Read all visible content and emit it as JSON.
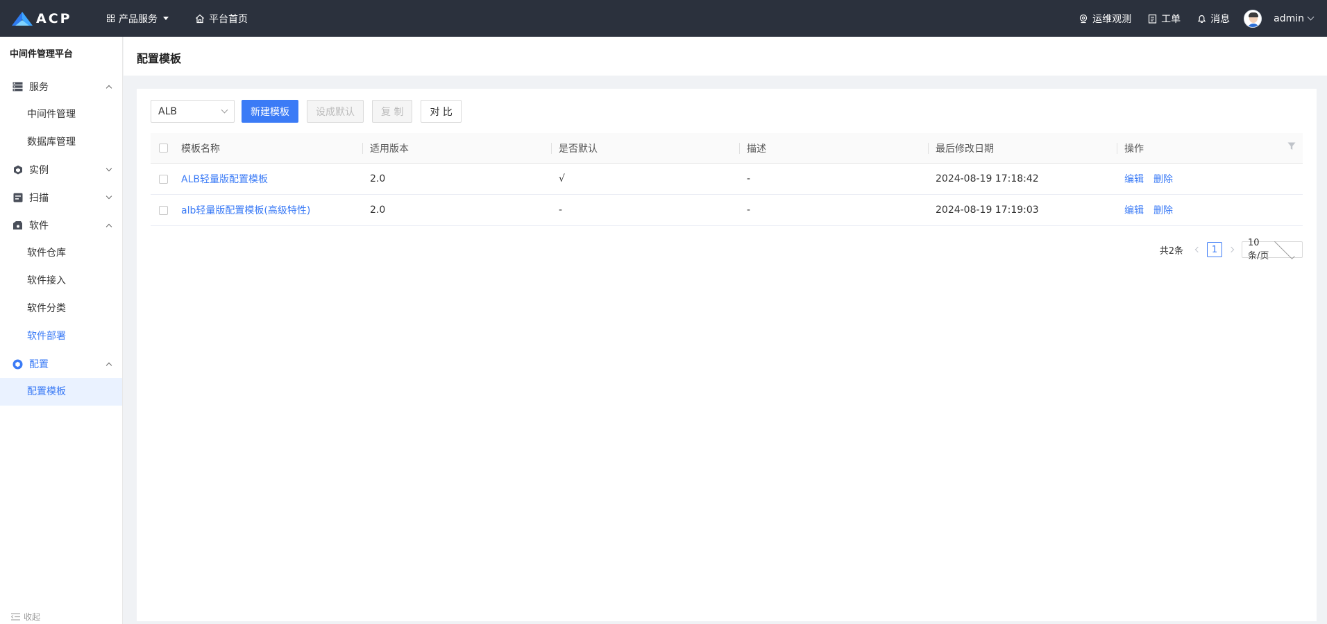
{
  "brand": {
    "name": "ACP"
  },
  "topnav": {
    "product_services": "产品服务",
    "platform_home": "平台首页"
  },
  "topright": {
    "ops": "运维观测",
    "ticket": "工单",
    "messages": "消息",
    "user": "admin"
  },
  "sidebar": {
    "platform_title": "中间件管理平台",
    "groups": {
      "service": {
        "label": "服务",
        "items": [
          "中间件管理",
          "数据库管理"
        ]
      },
      "instance": {
        "label": "实例"
      },
      "scan": {
        "label": "扫描"
      },
      "software": {
        "label": "软件",
        "items": [
          "软件仓库",
          "软件接入",
          "软件分类",
          "软件部署"
        ]
      },
      "config": {
        "label": "配置",
        "items": [
          "配置模板"
        ]
      }
    },
    "collapse": "收起"
  },
  "page": {
    "title": "配置模板"
  },
  "toolbar": {
    "select_value": "ALB",
    "new_template": "新建模板",
    "set_default": "设成默认",
    "copy": "复 制",
    "compare": "对 比"
  },
  "table": {
    "columns": [
      "模板名称",
      "适用版本",
      "是否默认",
      "描述",
      "最后修改日期",
      "操作"
    ],
    "rows": [
      {
        "name": "ALB轻量版配置模板",
        "version": "2.0",
        "is_default": "√",
        "desc": "-",
        "modified": "2024-08-19 17:18:42",
        "edit": "编辑",
        "delete": "删除"
      },
      {
        "name": "alb轻量版配置模板(高级特性)",
        "version": "2.0",
        "is_default": "-",
        "desc": "-",
        "modified": "2024-08-19 17:19:03",
        "edit": "编辑",
        "delete": "删除"
      }
    ]
  },
  "pagination": {
    "total": "共2条",
    "current_page": "1",
    "page_size": "10 条/页"
  },
  "colors": {
    "topbar_bg": "#2b313d",
    "accent": "#3b7bf6",
    "active_bg": "#eaf2ff"
  }
}
